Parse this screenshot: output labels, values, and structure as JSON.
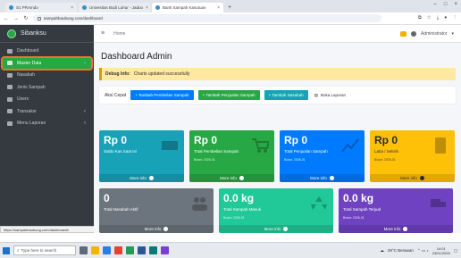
{
  "browser": {
    "tabs": [
      {
        "label": "S1 PRAIndo",
        "active": false
      },
      {
        "label": "Univesitas Budi Luhur - Jaduo",
        "active": false
      },
      {
        "label": "Bank Sampah Kasutuan",
        "active": true
      }
    ],
    "url": "sampahbaubung.com/dashboard",
    "status_link": "https://sampahbaubung.com/dashboard#"
  },
  "sidebar": {
    "brand": "Sibanksu",
    "items": [
      {
        "label": "Dashboard",
        "active": false,
        "has_chevron": false,
        "icon": "dashboard-icon"
      },
      {
        "label": "Master Data",
        "active": true,
        "has_chevron": true,
        "icon": "database-icon"
      },
      {
        "label": "Nasabah",
        "active": false,
        "has_chevron": false,
        "icon": "users-icon"
      },
      {
        "label": "Jenis Sampah",
        "active": false,
        "has_chevron": false,
        "icon": "recycle-icon"
      },
      {
        "label": "Users",
        "active": false,
        "has_chevron": false,
        "icon": "user-icon"
      },
      {
        "label": "Transaksi",
        "active": false,
        "has_chevron": true,
        "icon": "exchange-icon"
      },
      {
        "label": "Menu Laporan",
        "active": false,
        "has_chevron": true,
        "icon": "report-icon"
      }
    ]
  },
  "topnav": {
    "home_label": "Home",
    "user_label": "Administrator"
  },
  "page": {
    "title": "Dashboard Admin",
    "alert_title": "Debug Info:",
    "alert_text": "Charts updated successfully",
    "quick_label": "Aksi Cepat",
    "quick_buttons": [
      {
        "label": "+ Tambah Pembelian Sampah",
        "color": "blue"
      },
      {
        "label": "+ Tambah Penjualan Sampah",
        "color": "green"
      },
      {
        "label": "+ Tambah Nasabah",
        "color": "teal"
      },
      {
        "label": "Buka Laporan",
        "color": "link"
      }
    ]
  },
  "boxes_row1": [
    {
      "value": "Rp 0",
      "label": "Saldo Kas Saat Ini",
      "sub": "",
      "footer": "More info",
      "color": "#17a2b8",
      "icon": "money-icon"
    },
    {
      "value": "Rp 0",
      "label": "Total Pembelian Sampah",
      "sub": "Bulan: 2026-01",
      "footer": "More info",
      "color": "#28a745",
      "icon": "cart-icon"
    },
    {
      "value": "Rp 0",
      "label": "Total Penjualan Sampah",
      "sub": "Bulan: 2026-01",
      "footer": "More info",
      "color": "#007bff",
      "icon": "chart-icon"
    },
    {
      "value": "Rp 0",
      "label": "Laba / Selisih",
      "sub": "Bulan: 2026-01",
      "footer": "More info",
      "color": "#ffc107",
      "icon": "calculator-icon"
    }
  ],
  "boxes_row2": [
    {
      "value": "0",
      "label": "Total Nasabah Aktif",
      "sub": "",
      "footer": "More info",
      "color": "#6c757d",
      "icon": "people-icon"
    },
    {
      "value": "0.0 kg",
      "label": "Total Sampah Masuk",
      "sub": "Bulan: 2026-01",
      "footer": "More info",
      "color": "#20c997",
      "icon": "recycle-icon"
    },
    {
      "value": "0.0 kg",
      "label": "Total Sampah Terjual",
      "sub": "Bulan: 2026-01",
      "footer": "More info",
      "color": "#6f42c1",
      "icon": "truck-icon"
    }
  ],
  "taskbar": {
    "search_placeholder": "Type here to search",
    "weather": "29°C Berawan",
    "time": "14:01",
    "date": "23/01/2026"
  }
}
